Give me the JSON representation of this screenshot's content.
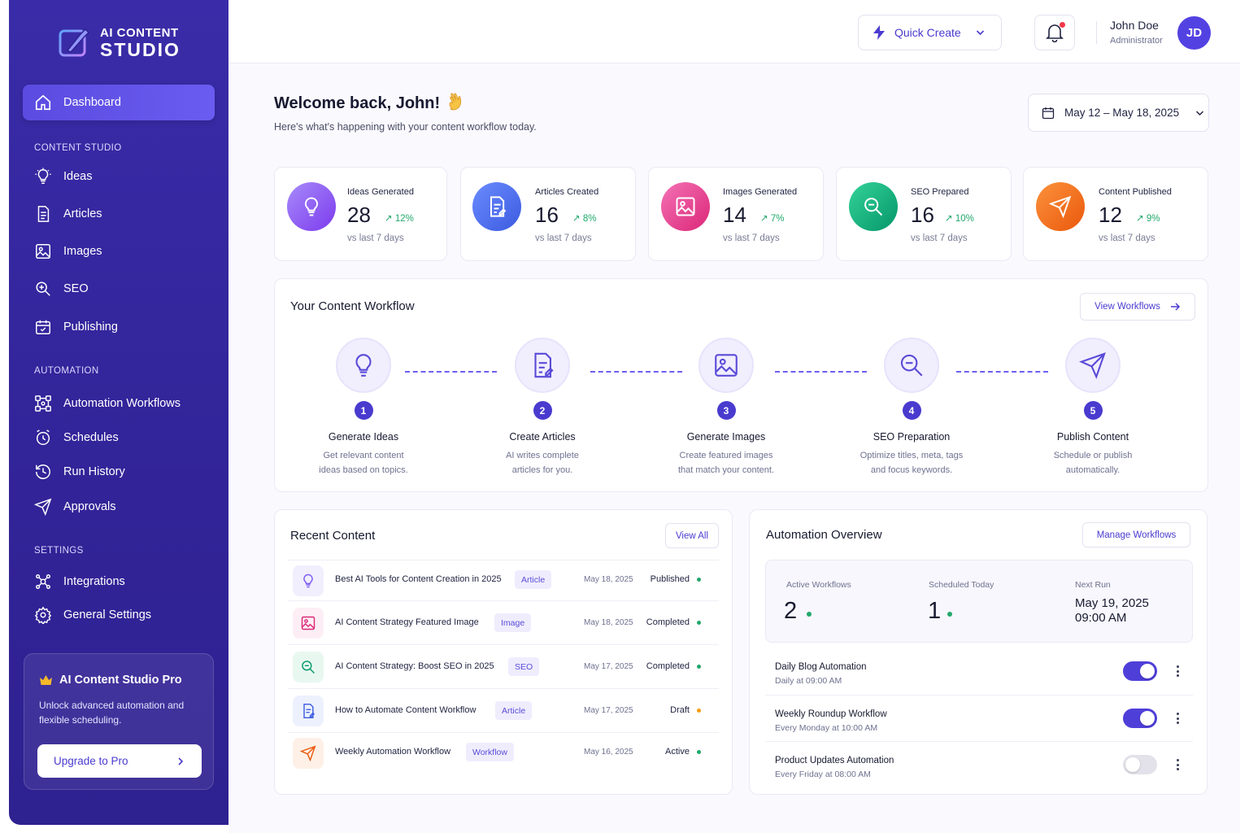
{
  "brand": {
    "line1": "AI CONTENT",
    "line2": "STUDIO"
  },
  "sidebar": {
    "dashboard": "Dashboard",
    "sections": {
      "content": "CONTENT STUDIO",
      "automation": "AUTOMATION",
      "settings": "SETTINGS"
    },
    "content_items": [
      {
        "label": "Ideas",
        "icon": "lightbulb-icon"
      },
      {
        "label": "Articles",
        "icon": "document-icon"
      },
      {
        "label": "Images",
        "icon": "image-icon"
      },
      {
        "label": "SEO",
        "icon": "seo-search-icon"
      },
      {
        "label": "Publishing",
        "icon": "calendar-publish-icon"
      }
    ],
    "automation_items": [
      {
        "label": "Automation Workflows",
        "icon": "workflow-icon"
      },
      {
        "label": "Schedules",
        "icon": "clock-icon"
      },
      {
        "label": "Run History",
        "icon": "history-icon"
      },
      {
        "label": "Approvals",
        "icon": "send-icon"
      }
    ],
    "settings_items": [
      {
        "label": "Integrations",
        "icon": "integrations-icon"
      },
      {
        "label": "General Settings",
        "icon": "gear-icon"
      }
    ],
    "pro": {
      "title": "AI Content Studio Pro",
      "description": "Unlock advanced automation and flexible scheduling.",
      "button": "Upgrade to Pro"
    }
  },
  "topbar": {
    "quick_create": "Quick Create",
    "user_name": "John Doe",
    "user_role": "Administrator",
    "avatar_initials": "JD"
  },
  "header": {
    "welcome": "Welcome back, John!",
    "subtitle": "Here's what's happening with your content workflow today.",
    "date_range": "May 12 – May 18, 2025"
  },
  "stats": [
    {
      "label": "Ideas Generated",
      "value": "28",
      "change": "12%",
      "foot": "vs last 7 days",
      "color": "#8b5cf6"
    },
    {
      "label": "Articles Created",
      "value": "16",
      "change": "8%",
      "foot": "vs last 7 days",
      "color": "#4f6df5"
    },
    {
      "label": "Images Generated",
      "value": "14",
      "change": "7%",
      "foot": "vs last 7 days",
      "color": "#ec4899"
    },
    {
      "label": "SEO Prepared",
      "value": "16",
      "change": "10%",
      "foot": "vs last 7 days",
      "color": "#10b981"
    },
    {
      "label": "Content Published",
      "value": "12",
      "change": "9%",
      "foot": "vs last 7 days",
      "color": "#f97316"
    }
  ],
  "workflow": {
    "title": "Your Content Workflow",
    "view_button": "View Workflows",
    "steps": [
      {
        "num": "1",
        "title": "Generate Ideas",
        "desc1": "Get relevant content",
        "desc2": "ideas based on topics."
      },
      {
        "num": "2",
        "title": "Create Articles",
        "desc1": "AI writes complete",
        "desc2": "articles for you."
      },
      {
        "num": "3",
        "title": "Generate Images",
        "desc1": "Create featured images",
        "desc2": "that match your content."
      },
      {
        "num": "4",
        "title": "SEO Preparation",
        "desc1": "Optimize titles, meta, tags",
        "desc2": "and focus keywords."
      },
      {
        "num": "5",
        "title": "Publish Content",
        "desc1": "Schedule or publish",
        "desc2": "automatically."
      }
    ]
  },
  "recent": {
    "title": "Recent Content",
    "view_all": "View All",
    "rows": [
      {
        "title": "Best AI Tools for Content Creation in 2025",
        "tag": "Article",
        "date": "May 18, 2025",
        "status": "Published",
        "status_color": "#20a86a"
      },
      {
        "title": "AI Content Strategy Featured Image",
        "tag": "Image",
        "date": "May 18, 2025",
        "status": "Completed",
        "status_color": "#20a86a"
      },
      {
        "title": "AI Content Strategy: Boost SEO in 2025",
        "tag": "SEO",
        "date": "May 17, 2025",
        "status": "Completed",
        "status_color": "#20a86a"
      },
      {
        "title": "How to Automate Content Workflow",
        "tag": "Article",
        "date": "May 17, 2025",
        "status": "Draft",
        "status_color": "#f59e0b"
      },
      {
        "title": "Weekly Automation Workflow",
        "tag": "Workflow",
        "date": "May 16, 2025",
        "status": "Active",
        "status_color": "#20a86a"
      }
    ]
  },
  "automation": {
    "title": "Automation Overview",
    "manage": "Manage Workflows",
    "active_label": "Active Workflows",
    "active_value": "2",
    "scheduled_label": "Scheduled Today",
    "scheduled_value": "1",
    "next_label": "Next Run",
    "next_date": "May 19, 2025",
    "next_time": "09:00 AM",
    "rows": [
      {
        "name": "Daily Blog Automation",
        "when": "Daily at 09:00 AM",
        "enabled": true
      },
      {
        "name": "Weekly Roundup Workflow",
        "when": "Every Monday at 10:00 AM",
        "enabled": true
      },
      {
        "name": "Product Updates Automation",
        "when": "Every Friday at 08:00 AM",
        "enabled": false
      }
    ]
  }
}
